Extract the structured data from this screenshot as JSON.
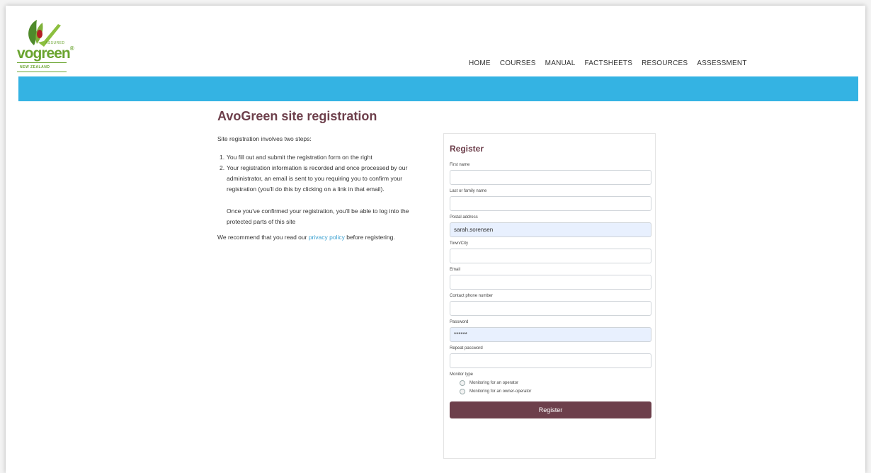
{
  "header": {
    "logo": {
      "assured": "ASSURED",
      "wordmark_prefix": "vo",
      "wordmark_main": "green",
      "registered": "®",
      "country": "NEW ZEALAND"
    },
    "nav": [
      "HOME",
      "COURSES",
      "MANUAL",
      "FACTSHEETS",
      "RESOURCES",
      "ASSESSMENT"
    ]
  },
  "colors": {
    "banner": "#34b3e3",
    "title": "#6d3f4b",
    "button": "#6d3f4b",
    "link": "#3aa0d0",
    "logo_green": "#6aa42f"
  },
  "main": {
    "title": "AvoGreen site registration",
    "intro": "Site registration involves two steps:",
    "steps": [
      {
        "num": "1.",
        "text": "You fill out and submit the registration form on the right"
      },
      {
        "num": "2.",
        "text": "Your registration information is recorded and once processed by our administrator, an email is sent to you requiring you to confirm your registration (you'll do this by clicking on a link in that email).",
        "extra": "Once you've confirmed your registration, you'll be able to log into the protected parts of this site"
      }
    ],
    "recommend_before": "We recommend that you read our ",
    "recommend_link": "privacy policy",
    "recommend_after": " before registering."
  },
  "form": {
    "title": "Register",
    "fields": {
      "first_name": {
        "label": "First name",
        "value": ""
      },
      "last_name": {
        "label": "Last or family name",
        "value": ""
      },
      "postal": {
        "label": "Postal address",
        "value": "sarah.sorensen"
      },
      "town": {
        "label": "Town/City",
        "value": ""
      },
      "email": {
        "label": "Email",
        "value": ""
      },
      "phone": {
        "label": "Contact phone number",
        "value": ""
      },
      "password": {
        "label": "Password",
        "value": "******"
      },
      "repeat_password": {
        "label": "Repeat password",
        "value": ""
      }
    },
    "monitor_type": {
      "label": "Monitor type",
      "options": [
        "Monitoring for an operator",
        "Monitoring for an owner-operator"
      ]
    },
    "submit_label": "Register"
  }
}
